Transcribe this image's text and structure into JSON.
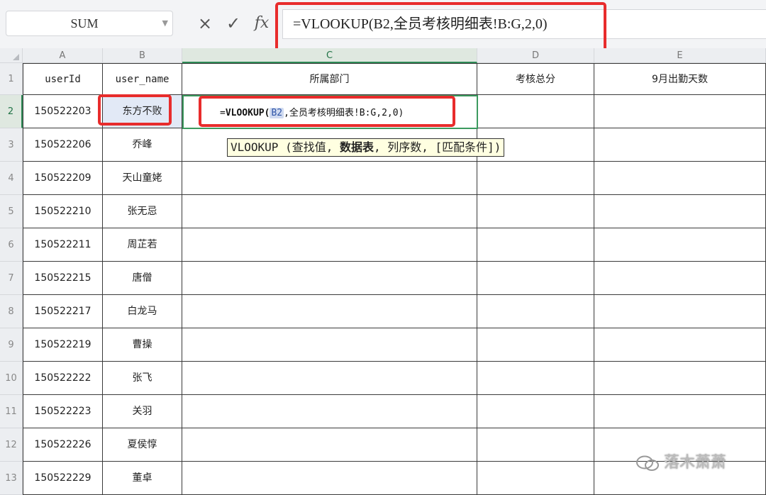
{
  "formula_bar": {
    "name_box": "SUM",
    "cancel_icon": "×",
    "confirm_icon": "✓",
    "fx_label": "fx",
    "formula": "=VLOOKUP(B2,全员考核明细表!B:G,2,0)"
  },
  "columns": [
    "A",
    "B",
    "C",
    "D",
    "E"
  ],
  "active_column": "C",
  "active_row": "2",
  "header_row": {
    "row_num": "1",
    "cells": [
      "userId",
      "user_name",
      "所属部门",
      "考核总分",
      "9月出勤天数"
    ]
  },
  "rows": [
    {
      "num": "2",
      "userId": "150522203",
      "user_name": "东方不败"
    },
    {
      "num": "3",
      "userId": "150522206",
      "user_name": "乔峰"
    },
    {
      "num": "4",
      "userId": "150522209",
      "user_name": "天山童姥"
    },
    {
      "num": "5",
      "userId": "150522210",
      "user_name": "张无忌"
    },
    {
      "num": "6",
      "userId": "150522211",
      "user_name": "周芷若"
    },
    {
      "num": "7",
      "userId": "150522215",
      "user_name": "唐僧"
    },
    {
      "num": "8",
      "userId": "150522217",
      "user_name": "白龙马"
    },
    {
      "num": "9",
      "userId": "150522219",
      "user_name": "曹操"
    },
    {
      "num": "10",
      "userId": "150522222",
      "user_name": "张飞"
    },
    {
      "num": "11",
      "userId": "150522223",
      "user_name": "关羽"
    },
    {
      "num": "12",
      "userId": "150522226",
      "user_name": "夏侯惇"
    },
    {
      "num": "13",
      "userId": "150522229",
      "user_name": "董卓"
    }
  ],
  "cell_formula": {
    "prefix": "=",
    "fn": "VLOOKUP",
    "open": "(",
    "ref": "B2",
    "rest": ",全员考核明细表!B:G,2,0)"
  },
  "tooltip": {
    "start": "VLOOKUP (查找值, ",
    "bold": "数据表",
    "end": ", 列序数, [匹配条件])"
  },
  "watermark": "落木萧萧",
  "colors": {
    "highlight_red": "#e82c2c",
    "active_green": "#3c9a5f",
    "ref_blue": "#2f56a8",
    "tooltip_bg": "#ffffe1"
  }
}
